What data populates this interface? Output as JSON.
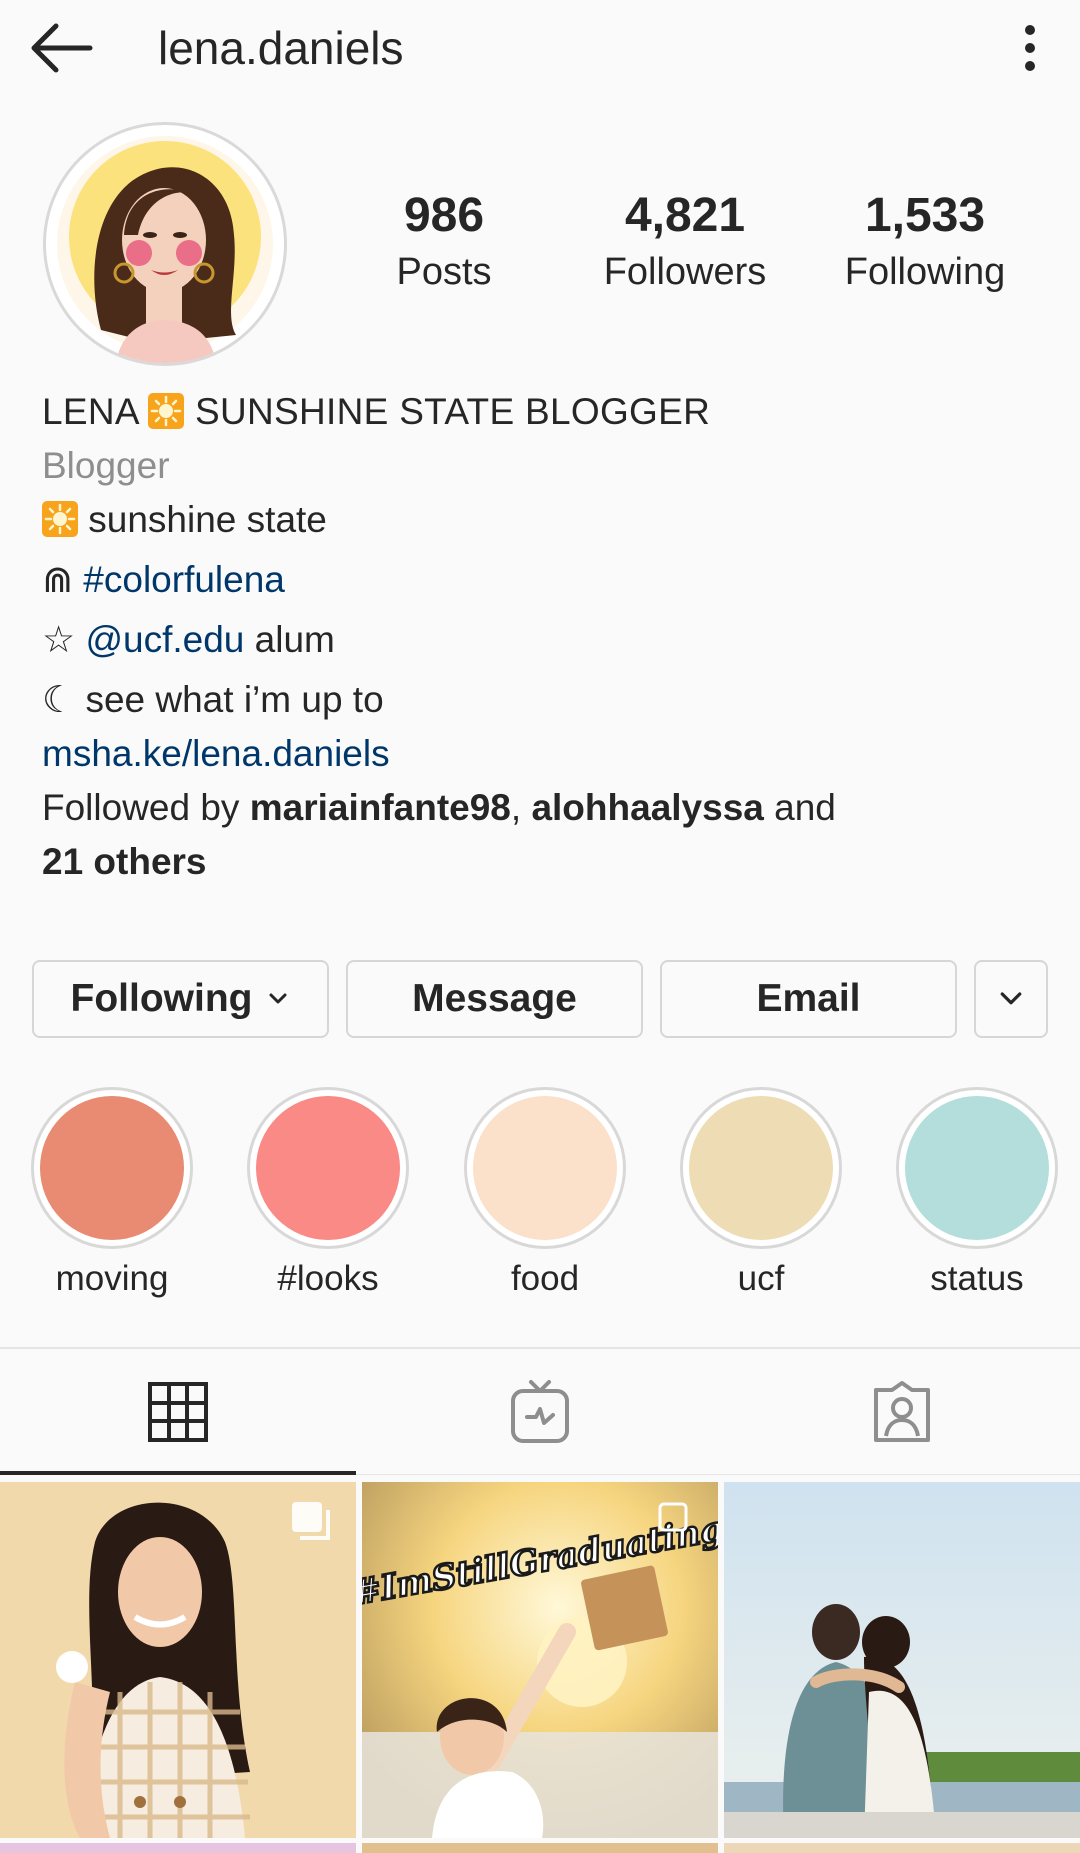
{
  "header": {
    "username": "lena.daniels",
    "back_icon": "arrow-left-icon",
    "menu_icon": "more-vertical-icon"
  },
  "stats": {
    "posts": {
      "value": "986",
      "label": "Posts"
    },
    "followers": {
      "value": "4,821",
      "label": "Followers"
    },
    "following": {
      "value": "1,533",
      "label": "Following"
    }
  },
  "bio": {
    "name_prefix": "LENA",
    "name_suffix": "SUNSHINE STATE BLOGGER",
    "category": "Blogger",
    "line1": "sunshine state",
    "line2_symbol": "⋒",
    "line2_hashtag": "#colorfulena",
    "line3_symbol": "☆",
    "line3_mention": "@ucf.edu",
    "line3_text": "alum",
    "line4_symbol": "☾",
    "line4_text": "see what i’m up to",
    "website": "msha.ke/lena.daniels",
    "followed_by_prefix": "Followed by",
    "followed_by_user1": "mariainfante98",
    "followed_by_user2": "alohhaalyssa",
    "followed_by_and": "and",
    "followed_by_others": "21 others"
  },
  "buttons": {
    "following": "Following",
    "message": "Message",
    "email": "Email"
  },
  "highlights": [
    {
      "label": "moving",
      "color": "#e98a72"
    },
    {
      "label": "#looks",
      "color": "#f98a86"
    },
    {
      "label": "food",
      "color": "#fbe0ca"
    },
    {
      "label": "ucf",
      "color": "#eedcb5"
    },
    {
      "label": "status",
      "color": "#b3dedb"
    }
  ],
  "tabs": [
    {
      "name": "grid",
      "icon": "grid-icon",
      "active": true
    },
    {
      "name": "igtv",
      "icon": "tv-icon",
      "active": false
    },
    {
      "name": "tagged",
      "icon": "tagged-person-icon",
      "active": false
    }
  ],
  "posts": [
    {
      "icon": "multi-photo-icon",
      "alt_text": ""
    },
    {
      "overlay_text": "#ImStillGraduating",
      "icon": "multi-photo-icon"
    },
    {
      "alt_text": ""
    }
  ],
  "colors": {
    "link": "#00376b",
    "text": "#262626",
    "muted": "#8e8e8e",
    "background": "#fafafa"
  }
}
